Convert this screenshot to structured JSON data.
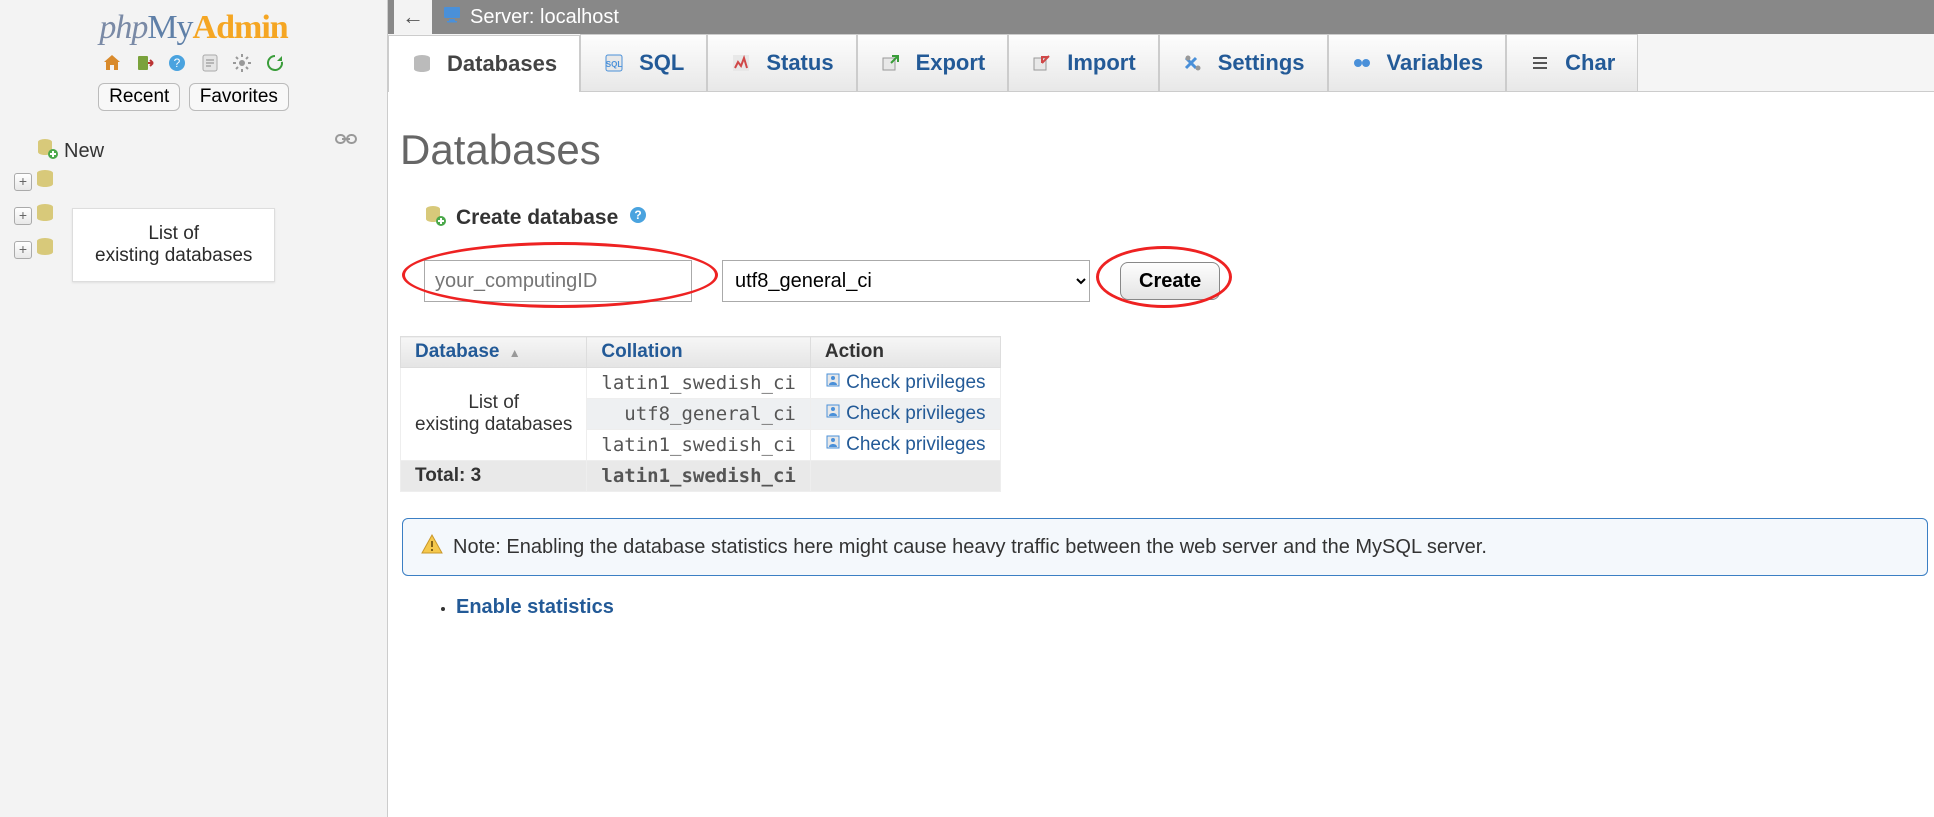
{
  "logo": {
    "part1": "php",
    "part2": "My",
    "part3": "Admin"
  },
  "sidebar": {
    "tabs": {
      "recent": "Recent",
      "favorites": "Favorites"
    },
    "new_label": "New",
    "collapsed_label": "List of\nexisting databases"
  },
  "server_bar": {
    "prefix": "Server:",
    "name": "localhost"
  },
  "tabs": [
    {
      "label": "Databases",
      "active": true
    },
    {
      "label": "SQL",
      "active": false
    },
    {
      "label": "Status",
      "active": false
    },
    {
      "label": "Export",
      "active": false
    },
    {
      "label": "Import",
      "active": false
    },
    {
      "label": "Settings",
      "active": false
    },
    {
      "label": "Variables",
      "active": false
    },
    {
      "label": "Char",
      "active": false
    }
  ],
  "page_title": "Databases",
  "create": {
    "heading": "Create database",
    "input_placeholder": "your_computingID",
    "collation_value": "utf8_general_ci",
    "button": "Create"
  },
  "table": {
    "headers": {
      "database": "Database",
      "collation": "Collation",
      "action": "Action"
    },
    "dbname_placeholder": "List of\nexisting databases",
    "rows": [
      {
        "collation": "latin1_swedish_ci",
        "action": "Check privileges"
      },
      {
        "collation": "utf8_general_ci",
        "action": "Check privileges"
      },
      {
        "collation": "latin1_swedish_ci",
        "action": "Check privileges"
      }
    ],
    "total_label": "Total: 3",
    "total_collation": "latin1_swedish_ci"
  },
  "notice": "Note: Enabling the database statistics here might cause heavy traffic between the web server and the MySQL server.",
  "enable_link": "Enable statistics"
}
